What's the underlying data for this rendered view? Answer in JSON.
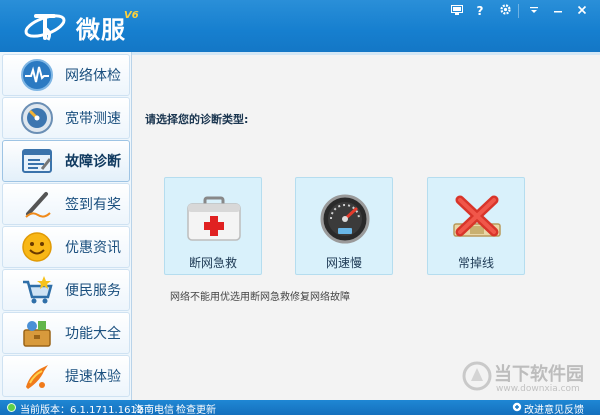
{
  "header": {
    "app_name": "微服",
    "version": "V6",
    "buttons": [
      "monitor-icon",
      "help-icon",
      "gear-icon",
      "menu-dropdown-icon",
      "minimize-icon",
      "close-icon"
    ],
    "help_label": "?"
  },
  "sidebar": {
    "items": [
      {
        "label": "网络体检",
        "icon": "network-check-icon"
      },
      {
        "label": "宽带测速",
        "icon": "speed-test-icon"
      },
      {
        "label": "故障诊断",
        "icon": "diagnosis-icon",
        "active": true
      },
      {
        "label": "签到有奖",
        "icon": "signin-pen-icon"
      },
      {
        "label": "优惠资讯",
        "icon": "smiley-icon"
      },
      {
        "label": "便民服务",
        "icon": "shopping-cart-icon"
      },
      {
        "label": "功能大全",
        "icon": "toolbox-icon"
      },
      {
        "label": "提速体验",
        "icon": "speed-up-icon"
      }
    ]
  },
  "main": {
    "prompt": "请选择您的诊断类型:",
    "cards": [
      {
        "label": "断网急救",
        "icon": "first-aid-kit-icon"
      },
      {
        "label": "网速慢",
        "icon": "speedometer-icon"
      },
      {
        "label": "常掉线",
        "icon": "disconnect-x-icon"
      }
    ],
    "hint": "网络不能用优选用断网急救修复网络故障"
  },
  "status": {
    "version_label": "当前版本：6.1.1711.1612",
    "isp": "海南电信",
    "check_update": "检查更新",
    "feedback": "改进意见反馈"
  },
  "watermark": {
    "text": "当下软件园",
    "url": "www.downxia.com"
  },
  "colors": {
    "titlebar": "#1a82d2",
    "accent_text": "#1a4f7e",
    "card_bg": "#d9f1fb",
    "status_ok": "#5ed14a"
  }
}
